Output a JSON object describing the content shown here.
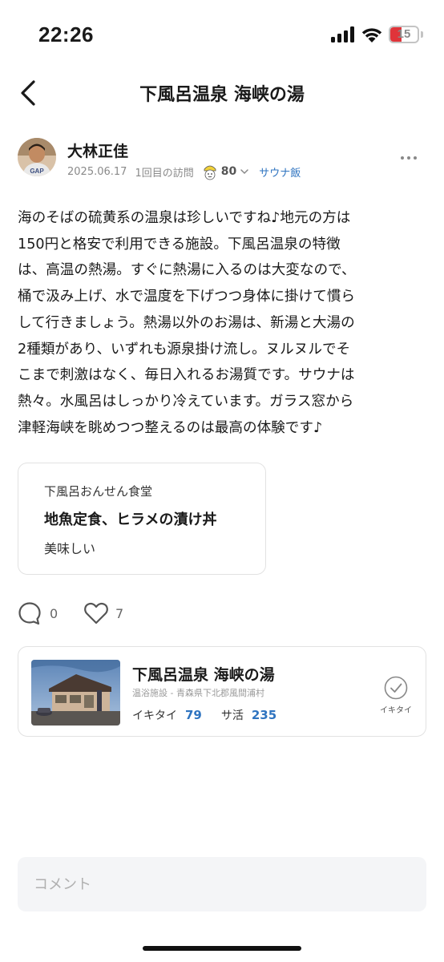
{
  "status_bar": {
    "time": "22:26",
    "battery_level": "15",
    "icons": [
      "signal-icon",
      "wifi-icon",
      "battery-icon"
    ]
  },
  "header": {
    "title": "下風呂温泉 海峡の湯",
    "back_icon": "chevron-left-icon"
  },
  "post": {
    "author": "大林正佳",
    "date": "2025.06.17",
    "visit": "1回目の訪問",
    "score": "80",
    "category": "サウナ飯",
    "more_icon": "more-horizontal-icon",
    "body": "海のそばの硫黄系の温泉は珍しいですね♪地元の方は\n150円と格安で利用できる施設。下風呂温泉の特徴\nは、高温の熱湯。すぐに熱湯に入るのは大変なので、\n桶で汲み上げ、水で温度を下げつつ身体に掛けて慣ら\nして行きましょう。熱湯以外のお湯は、新湯と大湯の\n2種類があり、いずれも源泉掛け流し。ヌルヌルでそ\nこまで刺激はなく、毎日入れるお湯質です。サウナは\n熱々。水風呂はしっかり冷えています。ガラス窓から\n津軽海峡を眺めつつ整えるのは最高の体験です♪"
  },
  "meal": {
    "shop": "下風呂おんせん食堂",
    "item": "地魚定食、ヒラメの漬け丼",
    "comment": "美味しい"
  },
  "reactions": {
    "comments": "0",
    "likes": "7"
  },
  "facility": {
    "name": "下風呂温泉 海峡の湯",
    "info": "温浴施設 - 青森県下北郡風間浦村",
    "ikitai_label": "イキタイ",
    "ikitai_count": "79",
    "sakatsu_label": "サ活",
    "sakatsu_count": "235",
    "button_label": "イキタイ"
  },
  "comment_input": {
    "placeholder": "コメント"
  },
  "colors": {
    "accent": "#2f74c0",
    "battery": "#e0343a"
  }
}
